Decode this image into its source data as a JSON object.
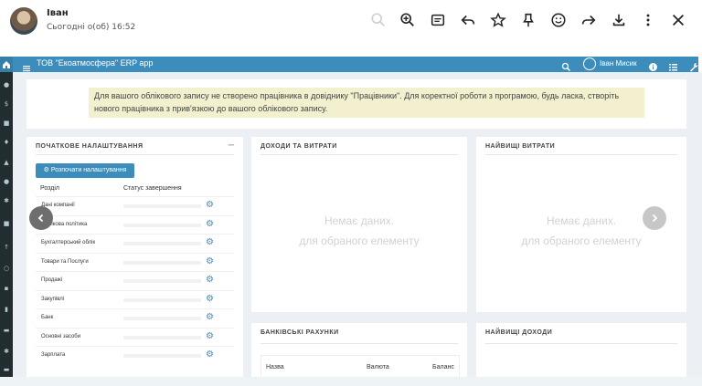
{
  "viewer": {
    "sender": "Іван",
    "sent_time": "Сьогодні о(об) 16:52",
    "icons": [
      "zoom-out-icon",
      "zoom-in-icon",
      "caption-icon",
      "reply-icon",
      "star-icon",
      "pin-icon",
      "emoji-icon",
      "forward-icon",
      "download-icon",
      "more-icon",
      "close-icon"
    ]
  },
  "navbar": {
    "title": "ТОВ \"Екоатмосфера\" ERP app",
    "user": "Іван Мисик",
    "color": "#3c8dbc"
  },
  "alert": {
    "text": "Для вашого облікового запису не створено працівника в довіднику \"Працівники\". Для коректної роботи з програмою, будь ласка, створіть нового працівника з прив'язкою до вашого облікового запису."
  },
  "setup_panel": {
    "title": "ПОЧАТКОВЕ НАЛАШТУВАННЯ",
    "collapse": "−",
    "button": "Розпочати налаштування",
    "col_section": "Розділ",
    "col_status": "Статус завершення",
    "rows": [
      "Дані компанії",
      "Облікова політика",
      "Бухгалтерський облік",
      "Товари та Послуги",
      "Продажі",
      "Закупівлі",
      "Банк",
      "Основні засоби",
      "Зарплата"
    ]
  },
  "income_panel": {
    "title": "ДОХОДИ ТА ВИТРАТИ",
    "empty_line1": "Немає даних.",
    "empty_line2": "для обраного елементу"
  },
  "expenses_panel": {
    "title": "НАЙВИЩІ ВИТРАТИ",
    "empty_line1": "Немає даних.",
    "empty_line2": "для обраного елементу"
  },
  "bank_panel": {
    "title": "БАНКІВСЬКІ РАХУНКИ",
    "col_name": "Назва",
    "col_currency": "Валюта",
    "col_balance": "Баланс"
  },
  "top_income_panel": {
    "title": "НАЙВИЩІ ДОХОДИ"
  }
}
